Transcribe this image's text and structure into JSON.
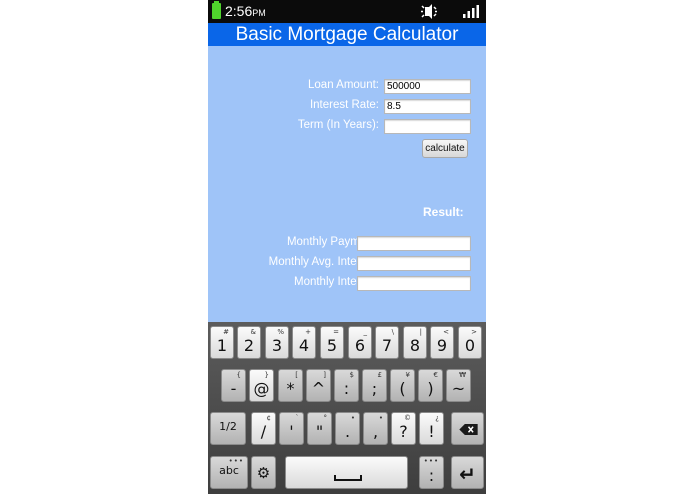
{
  "status_bar": {
    "time": "2:56",
    "ampm": "PM"
  },
  "app": {
    "title": "Basic Mortgage Calculator"
  },
  "form": {
    "loan_amount_label": "Loan Amount:",
    "loan_amount_value": "500000",
    "interest_rate_label": "Interest Rate:",
    "interest_rate_value": "8.5",
    "term_label": "Term (In Years):",
    "term_value": "",
    "calculate_label": "calculate"
  },
  "results": {
    "heading": "Result:",
    "monthly_payment_label": "Monthly Payment:",
    "monthly_payment_value": "",
    "monthly_avg_interest_label": "Monthly Avg. Interest:",
    "monthly_avg_interest_value": "",
    "monthly_interest_label": "Monthly Interest:",
    "monthly_interest_value": ""
  },
  "keyboard": {
    "row1": [
      {
        "main": "1",
        "sec": "#"
      },
      {
        "main": "2",
        "sec": "&"
      },
      {
        "main": "3",
        "sec": "%"
      },
      {
        "main": "4",
        "sec": "+"
      },
      {
        "main": "5",
        "sec": "="
      },
      {
        "main": "6",
        "sec": "_"
      },
      {
        "main": "7",
        "sec": "\\"
      },
      {
        "main": "8",
        "sec": "|"
      },
      {
        "main": "9",
        "sec": "<"
      },
      {
        "main": "0",
        "sec": ">"
      }
    ],
    "row2": [
      {
        "main": "-",
        "sec": "{"
      },
      {
        "main": "@",
        "sec": "}"
      },
      {
        "main": "*",
        "sec": "["
      },
      {
        "main": "^",
        "sec": "]"
      },
      {
        "main": ":",
        "sec": "$"
      },
      {
        "main": ";",
        "sec": "£"
      },
      {
        "main": "(",
        "sec": "¥"
      },
      {
        "main": ")",
        "sec": "€"
      },
      {
        "main": "~",
        "sec": "₩"
      }
    ],
    "row3_left": "1/2",
    "row3": [
      {
        "main": "/",
        "sec": "¢"
      },
      {
        "main": "'",
        "sec": "`"
      },
      {
        "main": "\"",
        "sec": "°"
      },
      {
        "main": ".",
        "sec": "•"
      },
      {
        "main": ",",
        "sec": "•"
      },
      {
        "main": "?",
        "sec": "©"
      },
      {
        "main": "!",
        "sec": "¿"
      }
    ],
    "abc_label": "abc",
    "colon_label": ":",
    "colon_dots": "•••",
    "abc_dots": "•••",
    "enter_glyph": "↵",
    "settings_glyph": "⚙"
  }
}
